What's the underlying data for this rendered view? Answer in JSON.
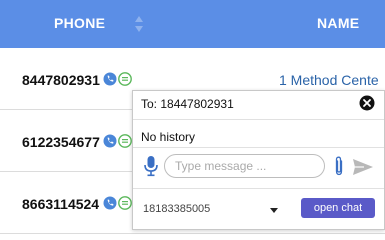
{
  "table": {
    "columns": {
      "phone": "PHONE",
      "name": "NAME"
    },
    "rows": [
      {
        "phone": "8447802931",
        "name": "1 Method Cente"
      },
      {
        "phone": "6122354677",
        "name": ""
      },
      {
        "phone": "8663114524",
        "name": ""
      }
    ]
  },
  "popup": {
    "to_label": "To: 18447802931",
    "history_text": "No history",
    "message_placeholder": "Type message ...",
    "from_number": "18183385005",
    "open_chat_label": "open chat"
  },
  "colors": {
    "header_bg": "#5b8ee6",
    "link": "#2a63a8",
    "call_icon": "#4a86d8",
    "chat_icon": "#5cb85c",
    "open_chat_bg": "#5a5ac8",
    "mic": "#3a6fc4"
  },
  "icons": [
    "sort-icon",
    "call-icon",
    "chat-icon",
    "close-icon",
    "microphone-icon",
    "paperclip-icon",
    "send-icon",
    "caret-down-icon"
  ]
}
